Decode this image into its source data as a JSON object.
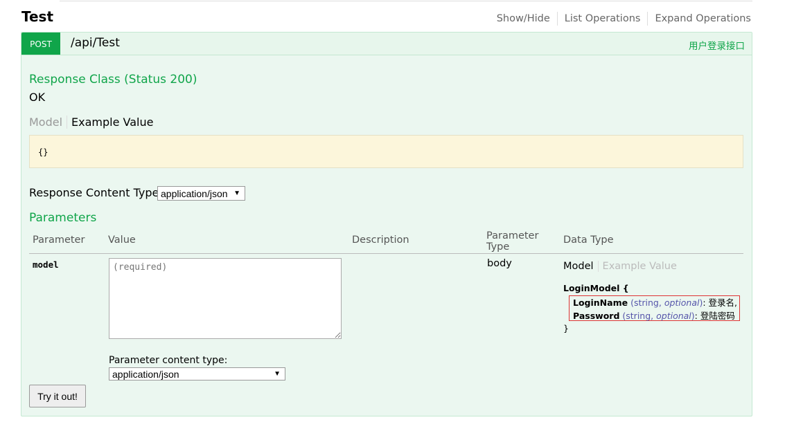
{
  "resource": {
    "title": "Test",
    "links": [
      "Show/Hide",
      "List Operations",
      "Expand Operations"
    ]
  },
  "operation": {
    "method": "POST",
    "path": "/api/Test",
    "summary": "用户登录接口",
    "response_class_heading": "Response Class (Status 200)",
    "response_text": "OK",
    "signature_tabs": [
      "Model",
      "Example Value"
    ],
    "example_value": "{}",
    "response_content_type_label": "Response Content Type",
    "response_content_type": "application/json",
    "parameters_heading": "Parameters",
    "columns": [
      "Parameter",
      "Value",
      "Description",
      "Parameter Type",
      "Data Type"
    ],
    "param": {
      "name": "model",
      "placeholder": "(required)",
      "param_type": "body",
      "datatype_tabs": [
        "Model",
        "Example Value"
      ],
      "model_name": "LoginModel {",
      "model_close": "}",
      "props": [
        {
          "name": "LoginName",
          "type": "string",
          "optional": "optional",
          "desc": ": 登录名,"
        },
        {
          "name": "Password",
          "type": "string",
          "optional": "optional",
          "desc": ": 登陆密码"
        }
      ],
      "content_type_label": "Parameter content type:",
      "content_type": "application/json"
    },
    "try_button": "Try it out!"
  }
}
